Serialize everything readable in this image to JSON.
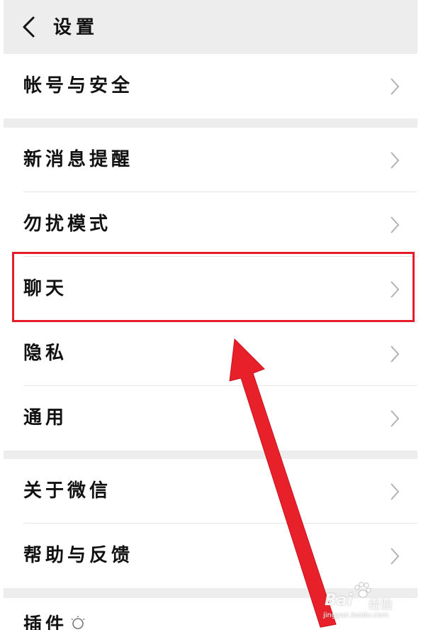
{
  "header": {
    "title": "设置",
    "back_icon": "chevron-left-icon"
  },
  "groups": [
    {
      "items": [
        {
          "label": "帐号与安全"
        }
      ]
    },
    {
      "items": [
        {
          "label": "新消息提醒"
        },
        {
          "label": "勿扰模式"
        },
        {
          "label": "聊天"
        },
        {
          "label": "隐私"
        },
        {
          "label": "通用"
        }
      ]
    },
    {
      "items": [
        {
          "label": "关于微信"
        },
        {
          "label": "帮助与反馈"
        }
      ]
    },
    {
      "items": [
        {
          "label": "插件",
          "icon": "lightbulb-icon"
        }
      ]
    }
  ],
  "annotation": {
    "highlighted_item": "聊天",
    "color": "#e61c2a"
  },
  "watermark": {
    "brand": "Bai",
    "text": "经验",
    "url": "jingyan.baidu.com"
  },
  "colors": {
    "background": "#ededed",
    "row": "#ffffff",
    "chevron": "#b2b2b2"
  }
}
